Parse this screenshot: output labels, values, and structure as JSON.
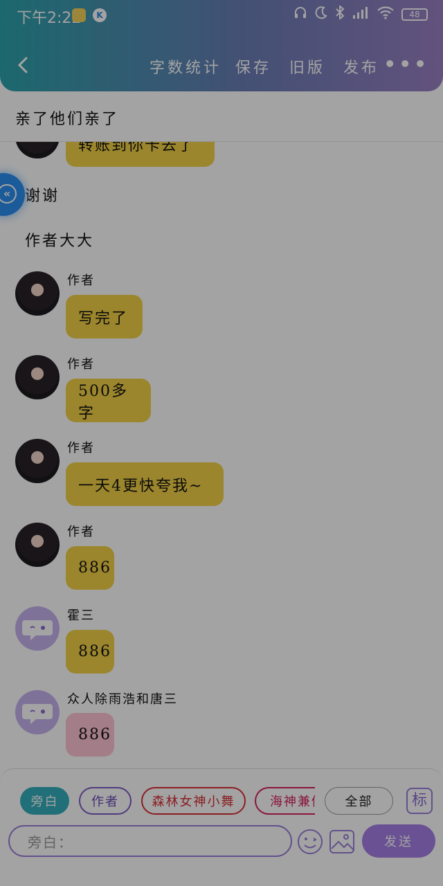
{
  "status_bar": {
    "time": "下午2:22",
    "app_badge_2": "K",
    "battery": "48"
  },
  "header": {
    "back_icon": "chevron-left-icon",
    "nav": [
      "字数统计",
      "保存",
      "旧版",
      "发布"
    ],
    "more": "•••"
  },
  "document_title": "亲了他们亲了",
  "messages": [
    {
      "kind": "bubble",
      "sender": "",
      "avatar": "photo",
      "text": "转账到你卡去了",
      "color": "#f3d247",
      "cropped": true
    },
    {
      "kind": "narration",
      "text": "谢谢"
    },
    {
      "kind": "narration",
      "text": "作者大大"
    },
    {
      "kind": "bubble",
      "sender": "作者",
      "avatar": "photo",
      "text": "写完了",
      "color": "#f3d247"
    },
    {
      "kind": "bubble",
      "sender": "作者",
      "avatar": "photo",
      "text": "500多字",
      "color": "#f3d247"
    },
    {
      "kind": "bubble",
      "sender": "作者",
      "avatar": "photo",
      "text": "一天4更快夸我~",
      "color": "#f3d247"
    },
    {
      "kind": "bubble",
      "sender": "作者",
      "avatar": "photo",
      "text": "886",
      "color": "#f3d247"
    },
    {
      "kind": "bubble",
      "sender": "霍三",
      "avatar": "chat-bubble-icon",
      "text": "886",
      "color": "#f3d247"
    },
    {
      "kind": "bubble",
      "sender": "众人除雨浩和唐三",
      "avatar": "chat-bubble-icon",
      "text": "886",
      "color": "#ffc4d3"
    }
  ],
  "roles": {
    "chips": [
      {
        "label": "旁白",
        "style": "active"
      },
      {
        "label": "作者",
        "style": "purple"
      },
      {
        "label": "森林女神小舞",
        "style": "red"
      },
      {
        "label": "海神兼修",
        "style": "pinkred"
      }
    ],
    "all_label": "全部",
    "tag_label": "标"
  },
  "composer": {
    "placeholder": "旁白：",
    "send_label": "发送",
    "emoji_icon": "smiley-icon",
    "image_icon": "image-icon"
  }
}
